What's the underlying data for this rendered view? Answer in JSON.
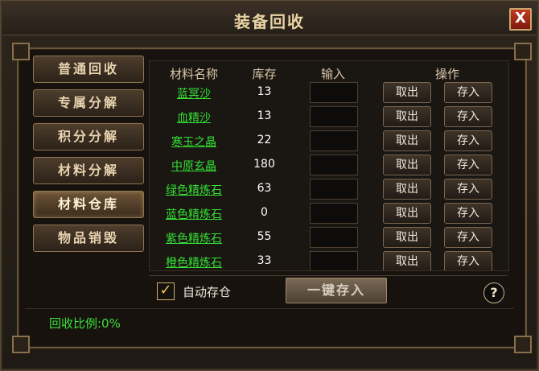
{
  "window": {
    "title": "装备回收",
    "close_label": "X"
  },
  "sidebar": {
    "items": [
      {
        "label": "普通回收"
      },
      {
        "label": "专属分解"
      },
      {
        "label": "积分分解"
      },
      {
        "label": "材料分解"
      },
      {
        "label": "材料仓库"
      },
      {
        "label": "物品销毁"
      }
    ]
  },
  "table": {
    "headers": [
      "材料名称",
      "库存",
      "输入",
      "操作"
    ],
    "rows": [
      {
        "name": "蓝冥沙",
        "stock": "13",
        "withdraw": "取出",
        "deposit": "存入"
      },
      {
        "name": "血精沙",
        "stock": "13",
        "withdraw": "取出",
        "deposit": "存入"
      },
      {
        "name": "寒玉之晶",
        "stock": "22",
        "withdraw": "取出",
        "deposit": "存入"
      },
      {
        "name": "中原玄晶",
        "stock": "180",
        "withdraw": "取出",
        "deposit": "存入"
      },
      {
        "name": "绿色精炼石",
        "stock": "63",
        "withdraw": "取出",
        "deposit": "存入"
      },
      {
        "name": "蓝色精炼石",
        "stock": "0",
        "withdraw": "取出",
        "deposit": "存入"
      },
      {
        "name": "紫色精炼石",
        "stock": "55",
        "withdraw": "取出",
        "deposit": "存入"
      },
      {
        "name": "橙色精炼石",
        "stock": "33",
        "withdraw": "取出",
        "deposit": "存入"
      }
    ]
  },
  "bottom": {
    "auto_store_label": "自动存仓",
    "one_click_deposit": "一键存入",
    "help_label": "?",
    "ratio": "回收比例:0%"
  },
  "colors": {
    "accent": "#34e034",
    "title": "#e9d2a4",
    "close": "#c43a20"
  }
}
